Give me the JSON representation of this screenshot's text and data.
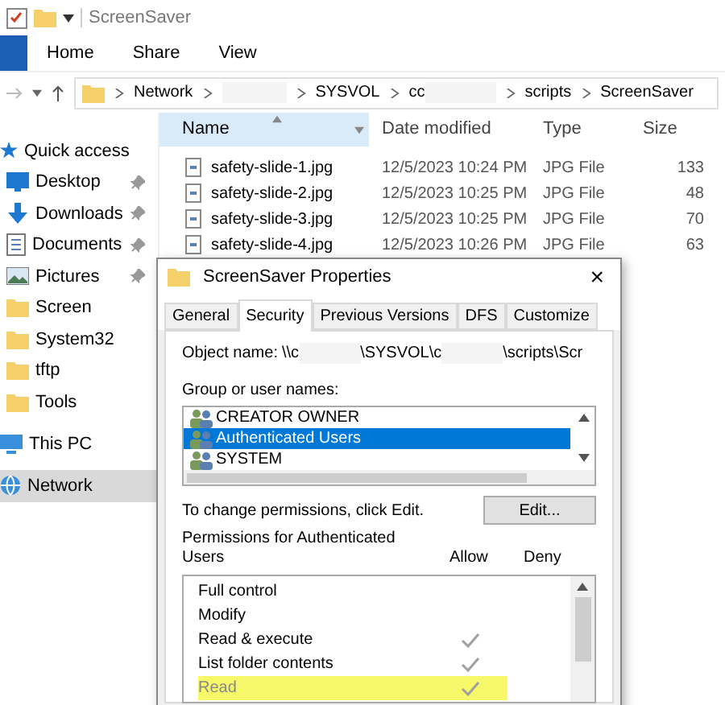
{
  "window": {
    "title": "ScreenSaver"
  },
  "ribbon_tabs": [
    {
      "label": "Home",
      "selected": false
    },
    {
      "label": "Share",
      "selected": false
    },
    {
      "label": "View",
      "selected": false
    }
  ],
  "breadcrumb": [
    {
      "kind": "text",
      "label": "Network"
    },
    {
      "kind": "redacted"
    },
    {
      "kind": "text",
      "label": "SYSVOL"
    },
    {
      "kind": "partial",
      "label": "cc"
    },
    {
      "kind": "text",
      "label": "scripts"
    },
    {
      "kind": "text",
      "label": "ScreenSaver"
    }
  ],
  "sidebar": {
    "items": [
      {
        "kind": "star",
        "label": "Quick access",
        "selected": false
      },
      {
        "kind": "desktop",
        "label": "Desktop",
        "pinned": true,
        "selected": false
      },
      {
        "kind": "download",
        "label": "Downloads",
        "pinned": true,
        "selected": false
      },
      {
        "kind": "doc",
        "label": "Documents",
        "pinned": true,
        "selected": false
      },
      {
        "kind": "picture",
        "label": "Pictures",
        "pinned": true,
        "selected": false
      },
      {
        "kind": "folder",
        "label": "Screen",
        "pinned": false,
        "selected": false
      },
      {
        "kind": "folder",
        "label": "System32",
        "pinned": false,
        "selected": false
      },
      {
        "kind": "folder",
        "label": "tftp",
        "pinned": false,
        "selected": false
      },
      {
        "kind": "folder",
        "label": "Tools",
        "pinned": false,
        "selected": false
      },
      {
        "kind": "pc",
        "label": "This PC",
        "selected": false
      },
      {
        "kind": "network",
        "label": "Network",
        "selected": true
      }
    ]
  },
  "table": {
    "columns": [
      "Name",
      "Date modified",
      "Type",
      "Size"
    ],
    "rows": [
      [
        "safety-slide-1.jpg",
        "12/5/2023 10:24 PM",
        "JPG File",
        "133"
      ],
      [
        "safety-slide-2.jpg",
        "12/5/2023 10:25 PM",
        "JPG File",
        "48"
      ],
      [
        "safety-slide-3.jpg",
        "12/5/2023 10:25 PM",
        "JPG File",
        "70"
      ],
      [
        "safety-slide-4.jpg",
        "12/5/2023 10:26 PM",
        "JPG File",
        "63"
      ]
    ]
  },
  "dialog": {
    "title": "ScreenSaver Properties",
    "close": "×",
    "tabs": [
      {
        "label": "General",
        "selected": false
      },
      {
        "label": "Security",
        "selected": true
      },
      {
        "label": "Previous Versions",
        "selected": false
      },
      {
        "label": "DFS",
        "selected": false
      },
      {
        "label": "Customize",
        "selected": false
      }
    ],
    "object_name_label": "Object name:",
    "object_name_parts": [
      {
        "kind": "text",
        "label": "\\\\c"
      },
      {
        "kind": "redacted"
      },
      {
        "kind": "text",
        "label": "\\SYSVOL\\c"
      },
      {
        "kind": "redacted"
      },
      {
        "kind": "text",
        "label": "\\scripts\\Scr"
      }
    ],
    "group_label": "Group or user names:",
    "groups": [
      {
        "label": "CREATOR OWNER",
        "selected": false
      },
      {
        "label": "Authenticated Users",
        "selected": true
      },
      {
        "label": "SYSTEM",
        "selected": false
      }
    ],
    "change_hint": "To change permissions, click Edit.",
    "edit_button": "Edit...",
    "permissions_label": "Permissions for Authenticated Users",
    "allow_header": "Allow",
    "deny_header": "Deny",
    "permissions": [
      {
        "label": "Full control",
        "allow": false,
        "deny": false,
        "highlighted": false
      },
      {
        "label": "Modify",
        "allow": false,
        "deny": false,
        "highlighted": false
      },
      {
        "label": "Read & execute",
        "allow": true,
        "deny": false,
        "highlighted": false
      },
      {
        "label": "List folder contents",
        "allow": true,
        "deny": false,
        "highlighted": false
      },
      {
        "label": "Read",
        "allow": true,
        "deny": false,
        "highlighted": true
      }
    ]
  }
}
